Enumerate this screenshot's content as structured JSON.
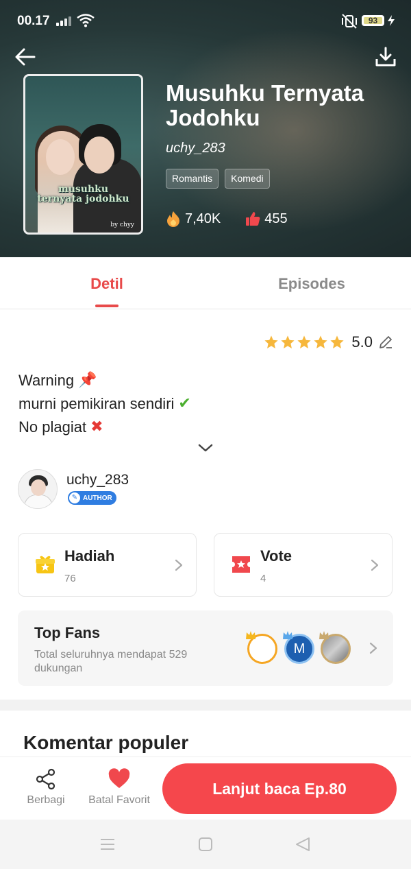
{
  "status_bar": {
    "time": "00.17",
    "battery": "93"
  },
  "book": {
    "title": "Musuhku Ternyata Jodohku",
    "author": "uchy_283",
    "tags": [
      "Romantis",
      "Komedi"
    ],
    "views": "7,40K",
    "likes": "455",
    "cover_title_line1": "musuhku",
    "cover_title_line2": "ternyata jodohku",
    "cover_by": "by chyy"
  },
  "tabs": {
    "detil": "Detil",
    "episodes": "Episodes",
    "active": "Detil"
  },
  "rating": {
    "value": "5.0",
    "stars": 5
  },
  "description": [
    {
      "text": "Warning",
      "emoji": "📌"
    },
    {
      "text": "murni pemikiran sendiri",
      "emoji": "✔"
    },
    {
      "text": "No plagiat",
      "emoji": "✖"
    }
  ],
  "author_card": {
    "name": "uchy_283",
    "badge": "AUTHOR"
  },
  "cards": {
    "hadiah": {
      "title": "Hadiah",
      "value": "76"
    },
    "vote": {
      "title": "Vote",
      "value": "4"
    }
  },
  "top_fans": {
    "title": "Top Fans",
    "subtitle": "Total seluruhnya mendapat 529 dukungan",
    "fan2_initial": "M"
  },
  "comments": {
    "title": "Komentar populer"
  },
  "bottom_bar": {
    "share_label": "Berbagi",
    "favorite_label": "Batal Favorit",
    "read_button": "Lanjut baca Ep.80"
  },
  "colors": {
    "accent": "#e84a4a",
    "button": "#f5474c",
    "star": "#f6b73c"
  }
}
